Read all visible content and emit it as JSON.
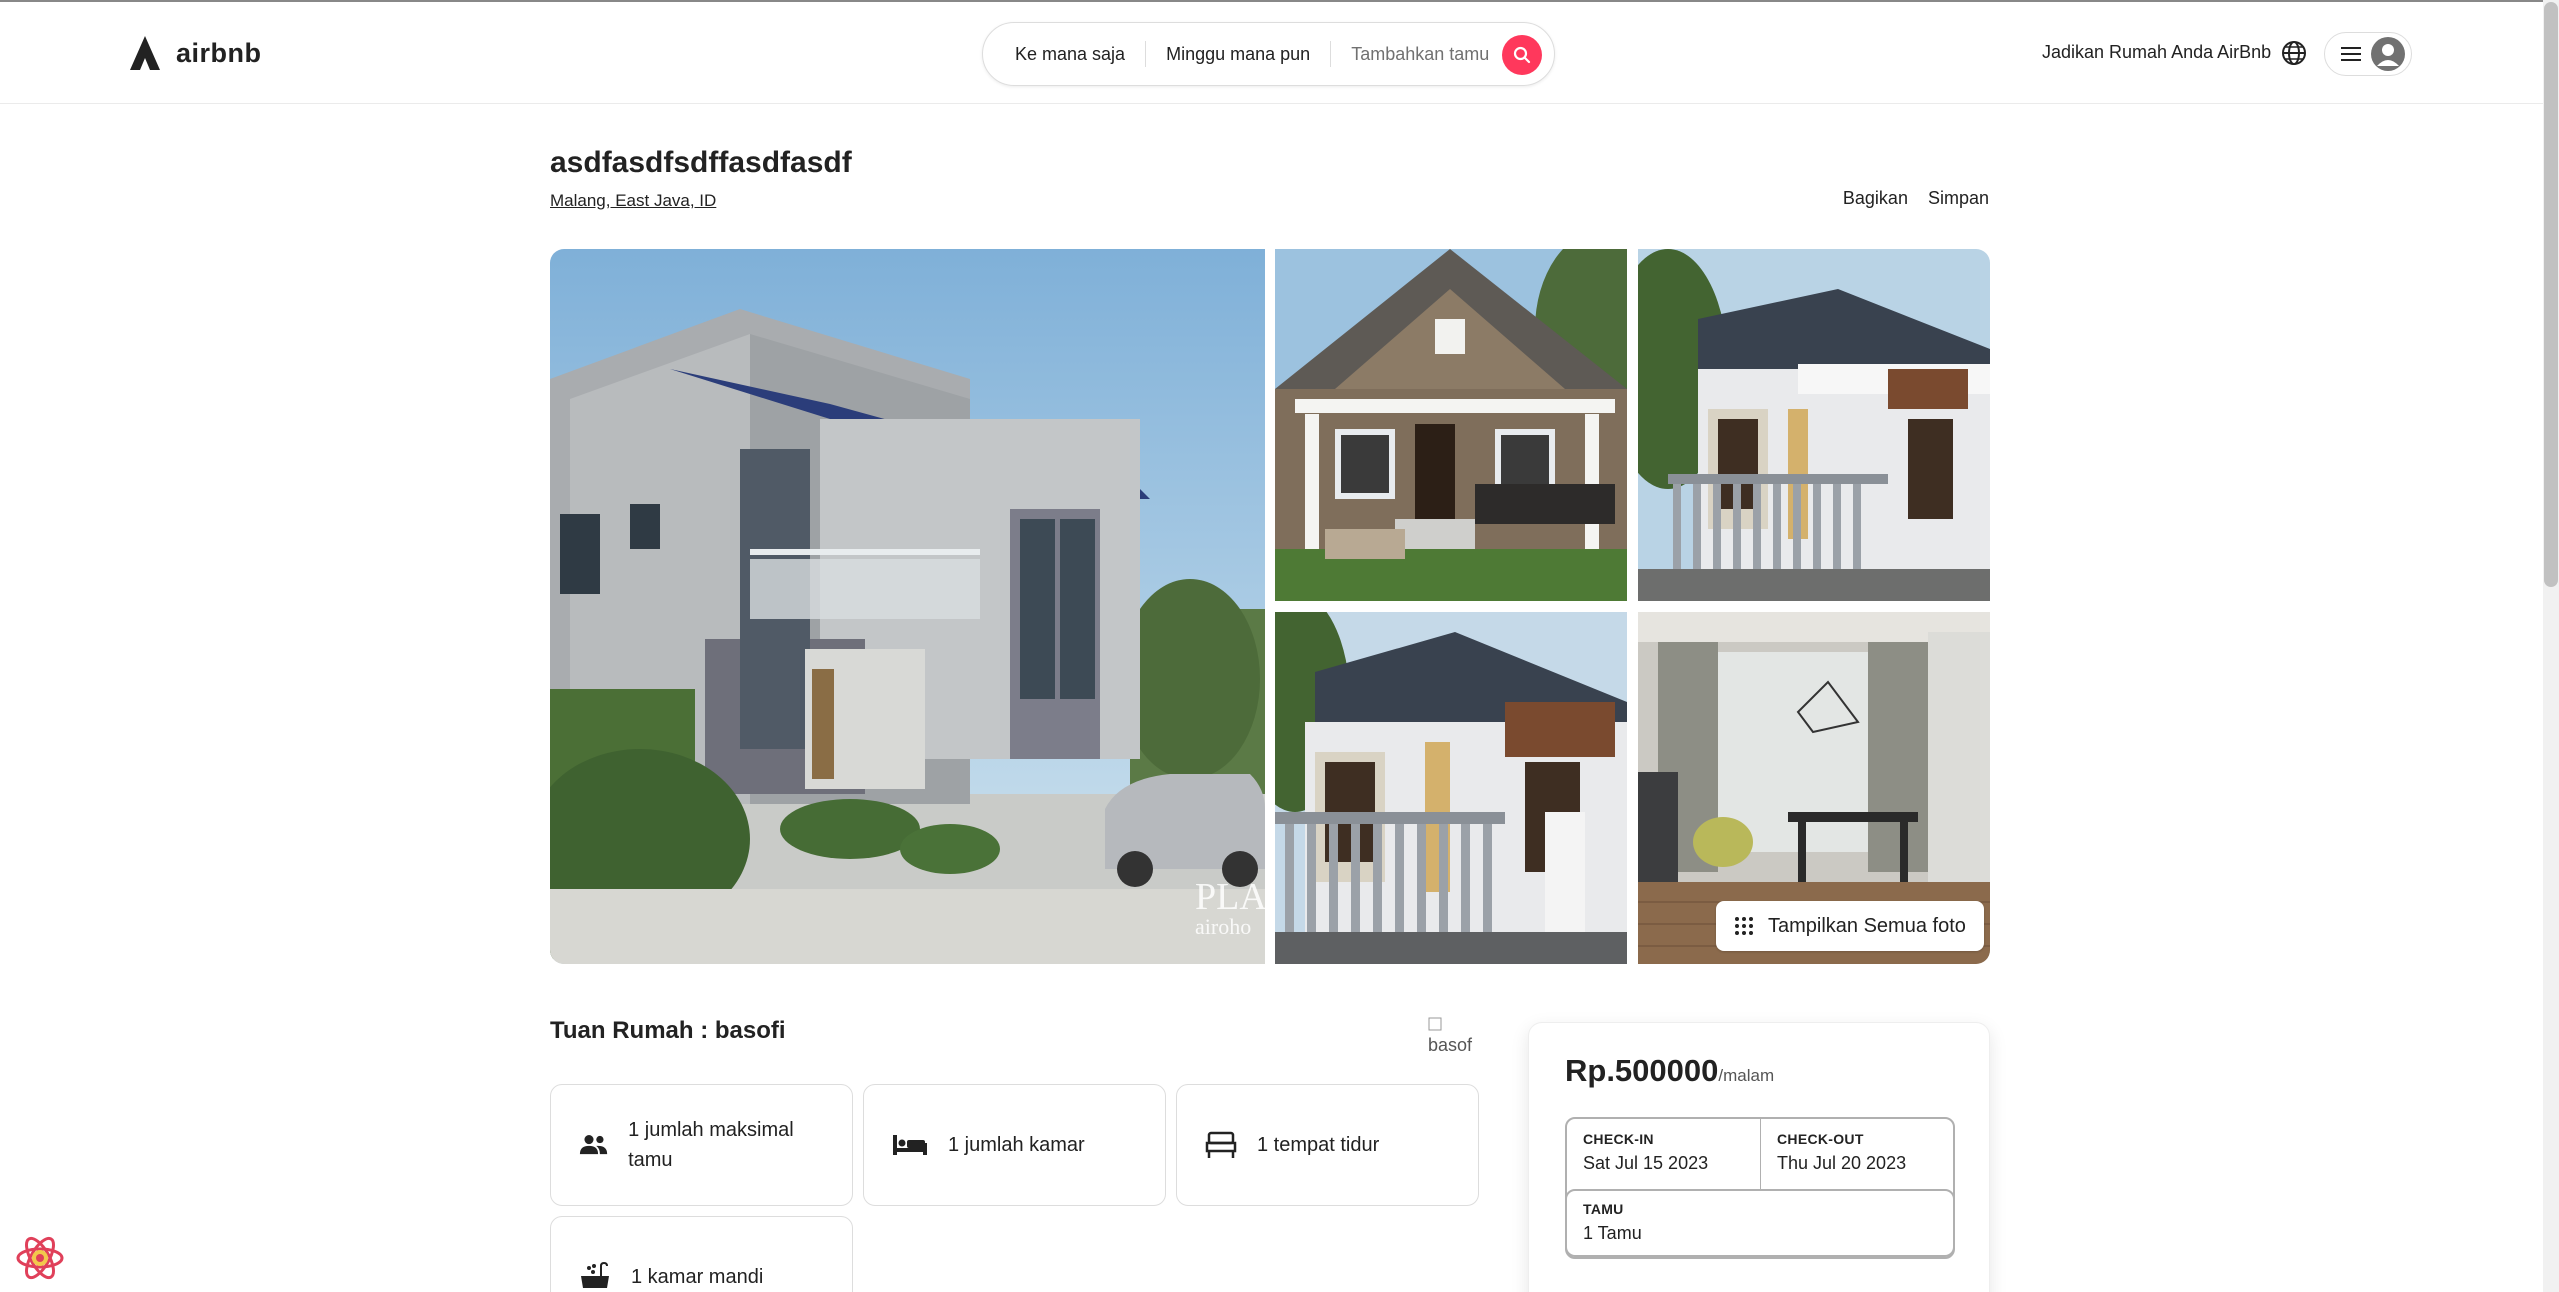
{
  "header": {
    "logo_text": "airbnb",
    "search": {
      "where": "Ke mana saja",
      "when": "Minggu mana pun",
      "guests_placeholder": "Tambahkan tamu"
    },
    "host_link": "Jadikan Rumah Anda AirBnb"
  },
  "listing": {
    "title": "asdfasdfsdffasdfasdf",
    "location": "Malang, East Java, ID",
    "share_label": "Bagikan",
    "save_label": "Simpan",
    "show_all_photos": "Tampilkan Semua foto",
    "photo_watermark_main": "PLA",
    "photo_watermark_sub": "airoho"
  },
  "host": {
    "title": "Tuan Rumah : basofi",
    "avatar_alt": "basof"
  },
  "amenities": [
    {
      "icon": "people-icon",
      "label": "1 jumlah maksimal tamu"
    },
    {
      "icon": "bed-icon",
      "label": "1 jumlah kamar"
    },
    {
      "icon": "bed-frame-icon",
      "label": "1 tempat tidur"
    },
    {
      "icon": "bathtub-icon",
      "label": "1 kamar mandi"
    }
  ],
  "booking": {
    "price": "Rp.500000",
    "price_unit": "/malam",
    "checkin_label": "CHECK-IN",
    "checkin_value": "Sat Jul 15 2023",
    "checkout_label": "CHECK-OUT",
    "checkout_value": "Thu Jul 20 2023",
    "guests_label": "TAMU",
    "guests_value": "1 Tamu"
  },
  "colors": {
    "brand": "#ff385c",
    "text": "#222222",
    "border": "#dddddd"
  }
}
